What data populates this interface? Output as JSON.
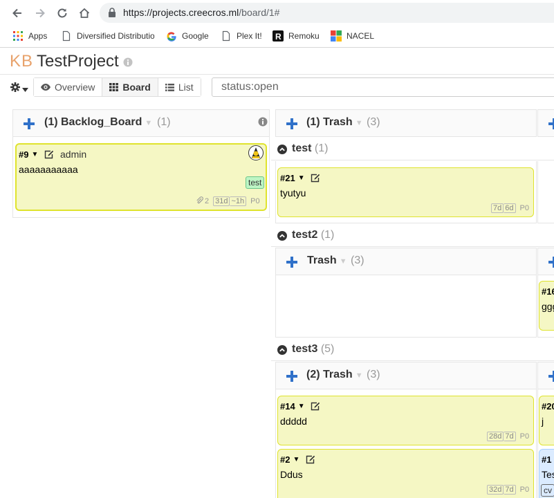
{
  "browser": {
    "url_host": "https://projects.creecros.ml",
    "url_path": "/board/1#"
  },
  "bookmarks": [
    {
      "label": "Apps",
      "icon": "apps-grid-icon"
    },
    {
      "label": "Diversified Distributio",
      "icon": "page-icon"
    },
    {
      "label": "Google",
      "icon": "google-icon"
    },
    {
      "label": "Plex It!",
      "icon": "page-icon"
    },
    {
      "label": "Remoku",
      "icon": "remoku-icon"
    },
    {
      "label": "NACEL",
      "icon": "nacel-icon"
    }
  ],
  "header": {
    "logo": "KB",
    "project_title": "TestProject"
  },
  "toolbar": {
    "views": [
      {
        "label": "Overview",
        "icon": "eye-icon"
      },
      {
        "label": "Board",
        "icon": "board-icon"
      },
      {
        "label": "List",
        "icon": "list-icon"
      }
    ],
    "active_view": "Board",
    "search_value": "status:open"
  },
  "colors": {
    "card_bg": "#f5f7c4",
    "card_border": "#dfe32d",
    "add_blue": "#3071c9",
    "tag_green": "#bdf5c4",
    "logo_orange": "#e8a26b"
  },
  "columns": {
    "backlog": {
      "title": "(1) Backlog_Board",
      "count": "(1)"
    },
    "trash_top": {
      "title": "(1) Trash",
      "count": "(3)"
    },
    "trash_test2": {
      "title": "Trash",
      "count": "(3)"
    },
    "trash_test3": {
      "title": "(2) Trash",
      "count": "(3)"
    }
  },
  "swimlanes": [
    {
      "name": "test",
      "count": "(1)"
    },
    {
      "name": "test2",
      "count": "(1)"
    },
    {
      "name": "test3",
      "count": "(5)"
    }
  ],
  "cards": {
    "c9": {
      "id": "#9",
      "owner": "admin",
      "title": "aaaaaaaaaaa",
      "tag": "test",
      "attachments": "2",
      "age": "31d",
      "due": "~1h",
      "priority": "P0"
    },
    "c21": {
      "id": "#21",
      "title": "tyutyu",
      "age": "7d",
      "due": "6d",
      "priority": "P0"
    },
    "c16": {
      "id": "#16",
      "title": "ggg"
    },
    "c14": {
      "id": "#14",
      "title": "ddddd",
      "age": "28d",
      "due": "7d",
      "priority": "P0"
    },
    "c20": {
      "id": "#20",
      "title": "j"
    },
    "c2": {
      "id": "#2",
      "title": "Ddus",
      "age": "32d",
      "due": "7d",
      "priority": "P0"
    },
    "c1": {
      "id": "#1",
      "title": "Tes",
      "tag": "cv"
    }
  }
}
